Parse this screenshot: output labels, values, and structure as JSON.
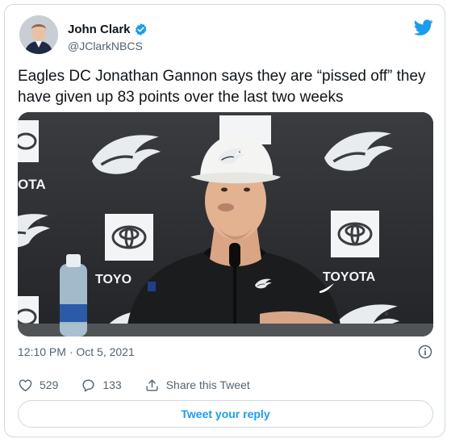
{
  "author": {
    "display_name": "John Clark",
    "handle": "@JClarkNBCS",
    "verified": true
  },
  "tweet": {
    "text": "Eagles DC Jonathan Gannon says they are “pissed off” they have given up 83 points over the last two weeks",
    "timestamp": "12:10 PM · Oct 5, 2021"
  },
  "media": {
    "backdrop_text_left": "OTA",
    "backdrop_text_mid_left": "TOYO",
    "backdrop_text_right": "TOYOTA"
  },
  "actions": {
    "likes_count": "529",
    "replies_count": "133",
    "share_label": "Share this Tweet"
  },
  "reply_button_label": "Tweet your reply",
  "colors": {
    "accent": "#1d9bf0",
    "text": "#0f1419",
    "muted": "#536471",
    "border": "#cfd9de"
  }
}
